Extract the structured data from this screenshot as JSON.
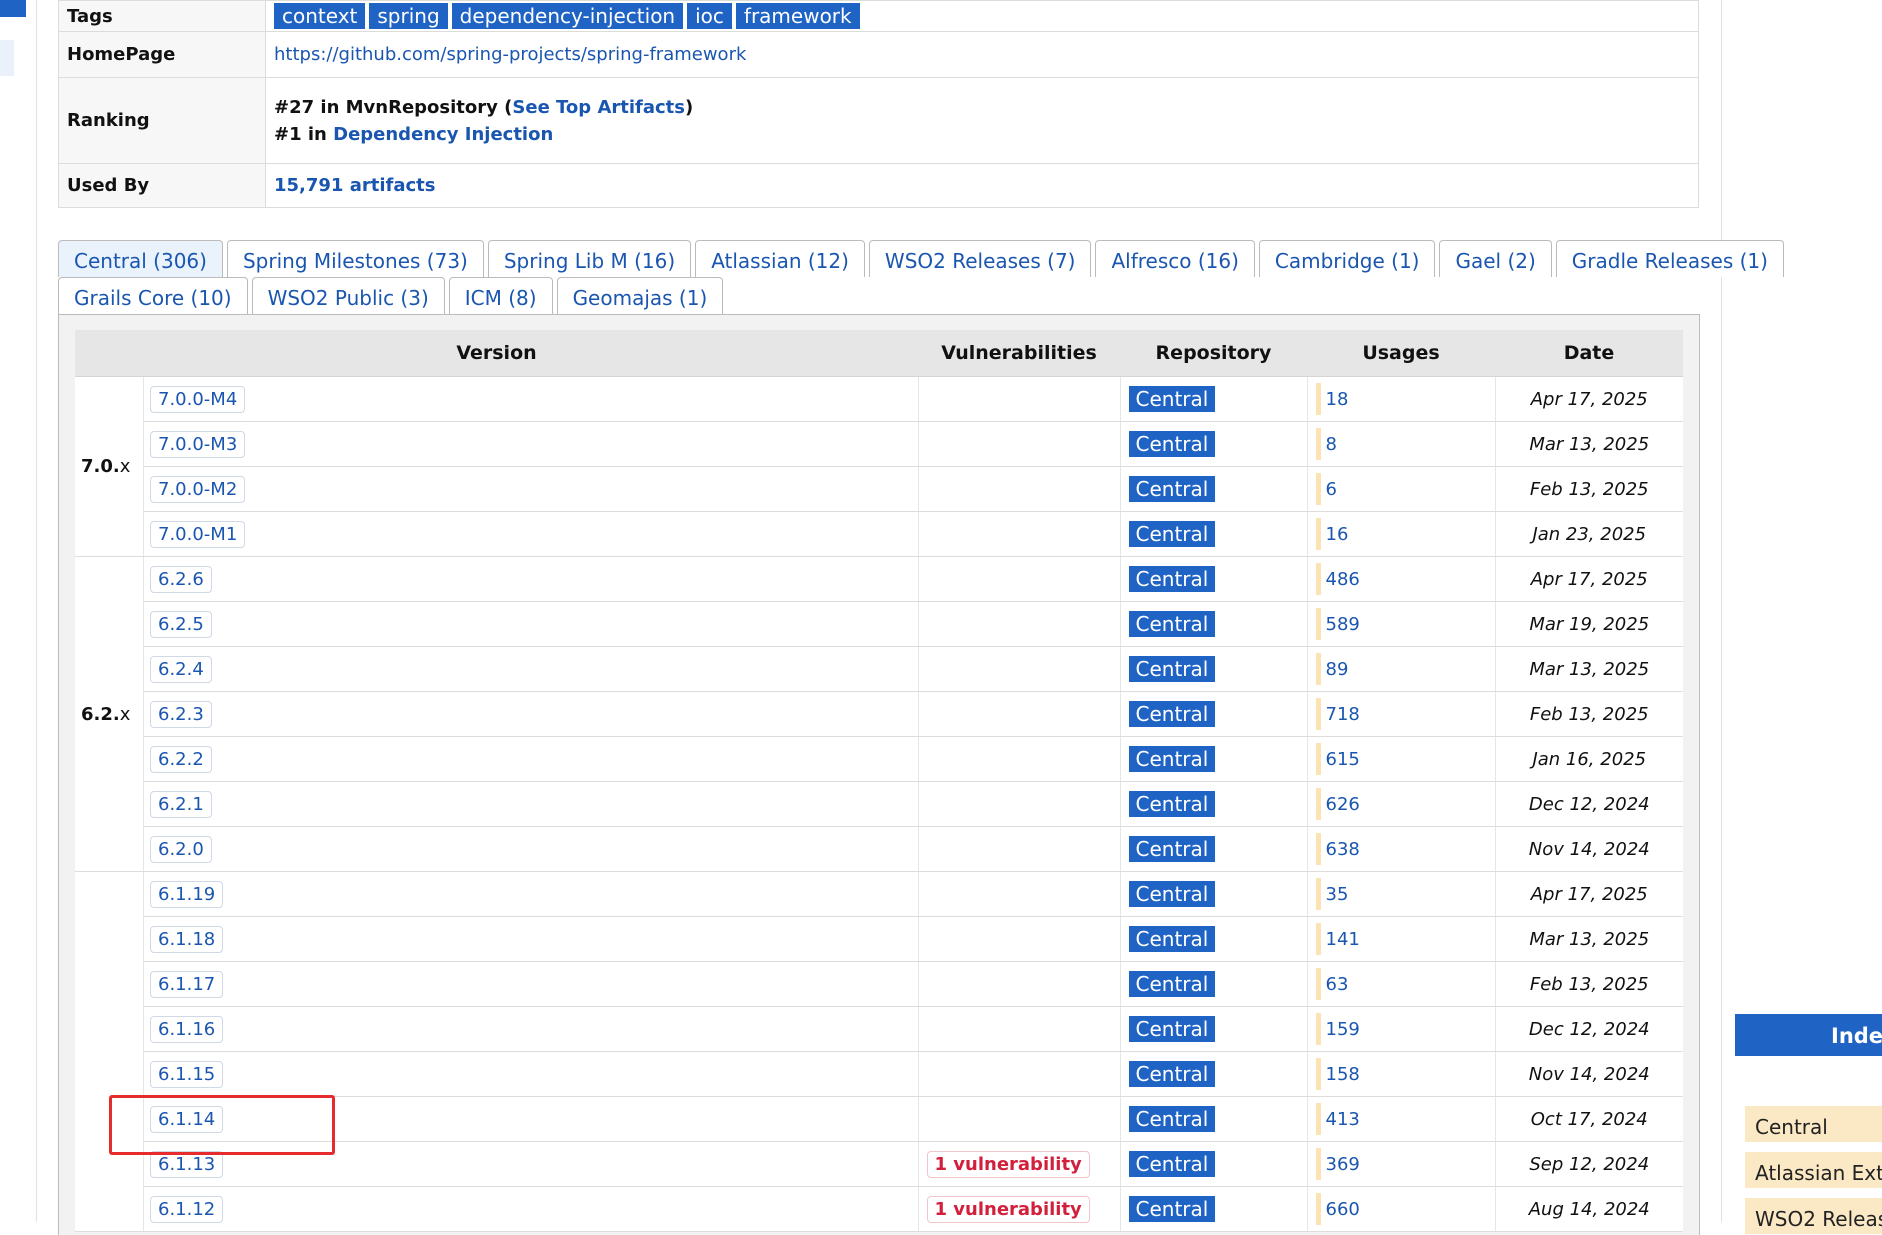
{
  "info": {
    "tags_label": "Tags",
    "tags": [
      "context",
      "spring",
      "dependency-injection",
      "ioc",
      "framework"
    ],
    "homepage_label": "HomePage",
    "homepage_url": "https://github.com/spring-projects/spring-framework",
    "ranking_label": "Ranking",
    "ranking_1_prefix": "#27 in MvnRepository (",
    "ranking_1_link": "See Top Artifacts",
    "ranking_1_suffix": ")",
    "ranking_2_prefix": "#1 in ",
    "ranking_2_link": "Dependency Injection",
    "usedby_label": "Used By",
    "usedby_value": "15,791 artifacts"
  },
  "tabs_row1": [
    "Central (306)",
    "Spring Milestones (73)",
    "Spring Lib M (16)",
    "Atlassian (12)",
    "WSO2 Releases (7)",
    "Alfresco (16)",
    "Cambridge (1)",
    "Gael (2)",
    "Gradle Releases (1)"
  ],
  "tabs_row2": [
    "Grails Core (10)",
    "WSO2 Public (3)",
    "ICM (8)",
    "Geomajas (1)"
  ],
  "table_headers": {
    "version": "Version",
    "vulnerabilities": "Vulnerabilities",
    "repository": "Repository",
    "usages": "Usages",
    "date": "Date"
  },
  "groups": [
    {
      "major": "7.0.",
      "suffix": "x"
    },
    {
      "major": "6.2.",
      "suffix": "x"
    }
  ],
  "versions": [
    {
      "version": "7.0.0-M4",
      "vuln": "",
      "repo": "Central",
      "usages": "18",
      "date": "Apr 17, 2025"
    },
    {
      "version": "7.0.0-M3",
      "vuln": "",
      "repo": "Central",
      "usages": "8",
      "date": "Mar 13, 2025"
    },
    {
      "version": "7.0.0-M2",
      "vuln": "",
      "repo": "Central",
      "usages": "6",
      "date": "Feb 13, 2025"
    },
    {
      "version": "7.0.0-M1",
      "vuln": "",
      "repo": "Central",
      "usages": "16",
      "date": "Jan 23, 2025"
    },
    {
      "version": "6.2.6",
      "vuln": "",
      "repo": "Central",
      "usages": "486",
      "date": "Apr 17, 2025"
    },
    {
      "version": "6.2.5",
      "vuln": "",
      "repo": "Central",
      "usages": "589",
      "date": "Mar 19, 2025"
    },
    {
      "version": "6.2.4",
      "vuln": "",
      "repo": "Central",
      "usages": "89",
      "date": "Mar 13, 2025"
    },
    {
      "version": "6.2.3",
      "vuln": "",
      "repo": "Central",
      "usages": "718",
      "date": "Feb 13, 2025"
    },
    {
      "version": "6.2.2",
      "vuln": "",
      "repo": "Central",
      "usages": "615",
      "date": "Jan 16, 2025"
    },
    {
      "version": "6.2.1",
      "vuln": "",
      "repo": "Central",
      "usages": "626",
      "date": "Dec 12, 2024"
    },
    {
      "version": "6.2.0",
      "vuln": "",
      "repo": "Central",
      "usages": "638",
      "date": "Nov 14, 2024"
    },
    {
      "version": "6.1.19",
      "vuln": "",
      "repo": "Central",
      "usages": "35",
      "date": "Apr 17, 2025"
    },
    {
      "version": "6.1.18",
      "vuln": "",
      "repo": "Central",
      "usages": "141",
      "date": "Mar 13, 2025"
    },
    {
      "version": "6.1.17",
      "vuln": "",
      "repo": "Central",
      "usages": "63",
      "date": "Feb 13, 2025"
    },
    {
      "version": "6.1.16",
      "vuln": "",
      "repo": "Central",
      "usages": "159",
      "date": "Dec 12, 2024"
    },
    {
      "version": "6.1.15",
      "vuln": "",
      "repo": "Central",
      "usages": "158",
      "date": "Nov 14, 2024"
    },
    {
      "version": "6.1.14",
      "vuln": "",
      "repo": "Central",
      "usages": "413",
      "date": "Oct 17, 2024"
    },
    {
      "version": "6.1.13",
      "vuln": "1 vulnerability",
      "repo": "Central",
      "usages": "369",
      "date": "Sep 12, 2024"
    },
    {
      "version": "6.1.12",
      "vuln": "1 vulnerability",
      "repo": "Central",
      "usages": "660",
      "date": "Aug 14, 2024"
    }
  ],
  "sidebar": {
    "index_header": "Index",
    "items": [
      "Central",
      "Atlassian Exte",
      "WSO2 Releas"
    ]
  }
}
